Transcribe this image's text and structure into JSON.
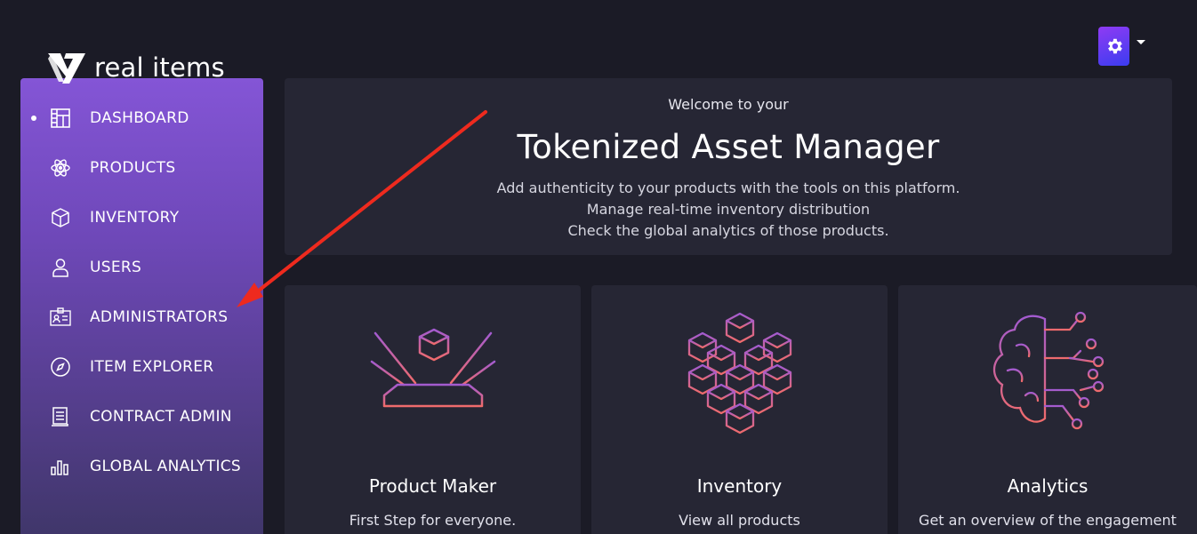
{
  "brand": {
    "name": "real items"
  },
  "header": {
    "user_menu_icon": "gear-icon"
  },
  "sidebar": {
    "items": [
      {
        "label": "DASHBOARD",
        "icon": "dashboard-icon",
        "active": true
      },
      {
        "label": "PRODUCTS",
        "icon": "atom-icon",
        "active": false
      },
      {
        "label": "INVENTORY",
        "icon": "box-icon",
        "active": false
      },
      {
        "label": "USERS",
        "icon": "user-icon",
        "active": false
      },
      {
        "label": "ADMINISTRATORS",
        "icon": "id-card-icon",
        "active": false
      },
      {
        "label": "ITEM EXPLORER",
        "icon": "compass-icon",
        "active": false
      },
      {
        "label": "CONTRACT ADMIN",
        "icon": "document-icon",
        "active": false
      },
      {
        "label": "GLOBAL ANALYTICS",
        "icon": "bar-chart-icon",
        "active": false
      }
    ]
  },
  "welcome": {
    "subtitle": "Welcome to your",
    "title": "Tokenized Asset Manager",
    "lines": [
      "Add authenticity to your products with the tools on this platform.",
      "Manage real-time inventory distribution",
      "Check the global analytics of those products."
    ]
  },
  "cards": [
    {
      "title": "Product Maker",
      "description": "First Step for everyone.",
      "icon": "hologram-cube-icon"
    },
    {
      "title": "Inventory",
      "description": "View all products",
      "icon": "cube-grid-icon"
    },
    {
      "title": "Analytics",
      "description": "Get an overview of the engagement",
      "icon": "brain-circuit-icon"
    }
  ],
  "colors": {
    "background": "#1b1b26",
    "panel": "#262634",
    "sidebar_top": "#8455d6",
    "sidebar_bottom": "#3f3669",
    "illustration_start": "#a35bd0",
    "illustration_end": "#f06b6b",
    "annotation_arrow": "#ee2a1e"
  }
}
